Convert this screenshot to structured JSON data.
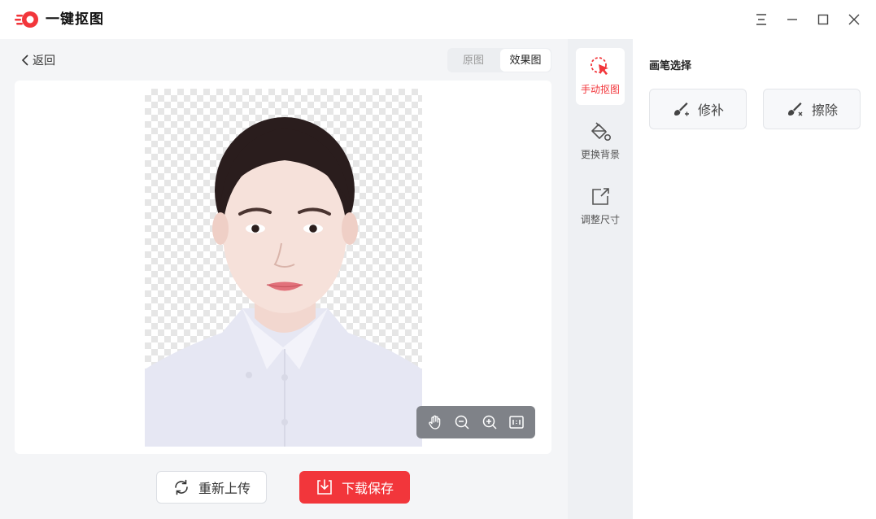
{
  "app": {
    "title": "一键抠图"
  },
  "window_controls": [
    "menu-icon",
    "minimize-icon",
    "maximize-icon",
    "close-icon"
  ],
  "nav": {
    "back_label": "返回"
  },
  "view_toggle": {
    "original_label": "原图",
    "result_label": "效果图",
    "selected": "效果图"
  },
  "actions": {
    "reupload_label": "重新上传",
    "download_label": "下载保存"
  },
  "zoom_toolbar": [
    "hand-icon",
    "zoom-out-icon",
    "zoom-in-icon",
    "fit-screen-icon"
  ],
  "tools": [
    {
      "label": "手动抠图",
      "icon": "cursor-click-icon",
      "active": true
    },
    {
      "label": "更换背景",
      "icon": "paint-bucket-icon",
      "active": false
    },
    {
      "label": "调整尺寸",
      "icon": "resize-icon",
      "active": false
    }
  ],
  "brush_panel": {
    "title": "画笔选择",
    "options": [
      {
        "label": "修补",
        "icon": "brush-add-icon"
      },
      {
        "label": "擦除",
        "icon": "brush-erase-icon"
      }
    ]
  },
  "colors": {
    "accent": "#f2363b",
    "rail_bg": "#eef0f3",
    "page_bg": "#f4f5f7"
  }
}
